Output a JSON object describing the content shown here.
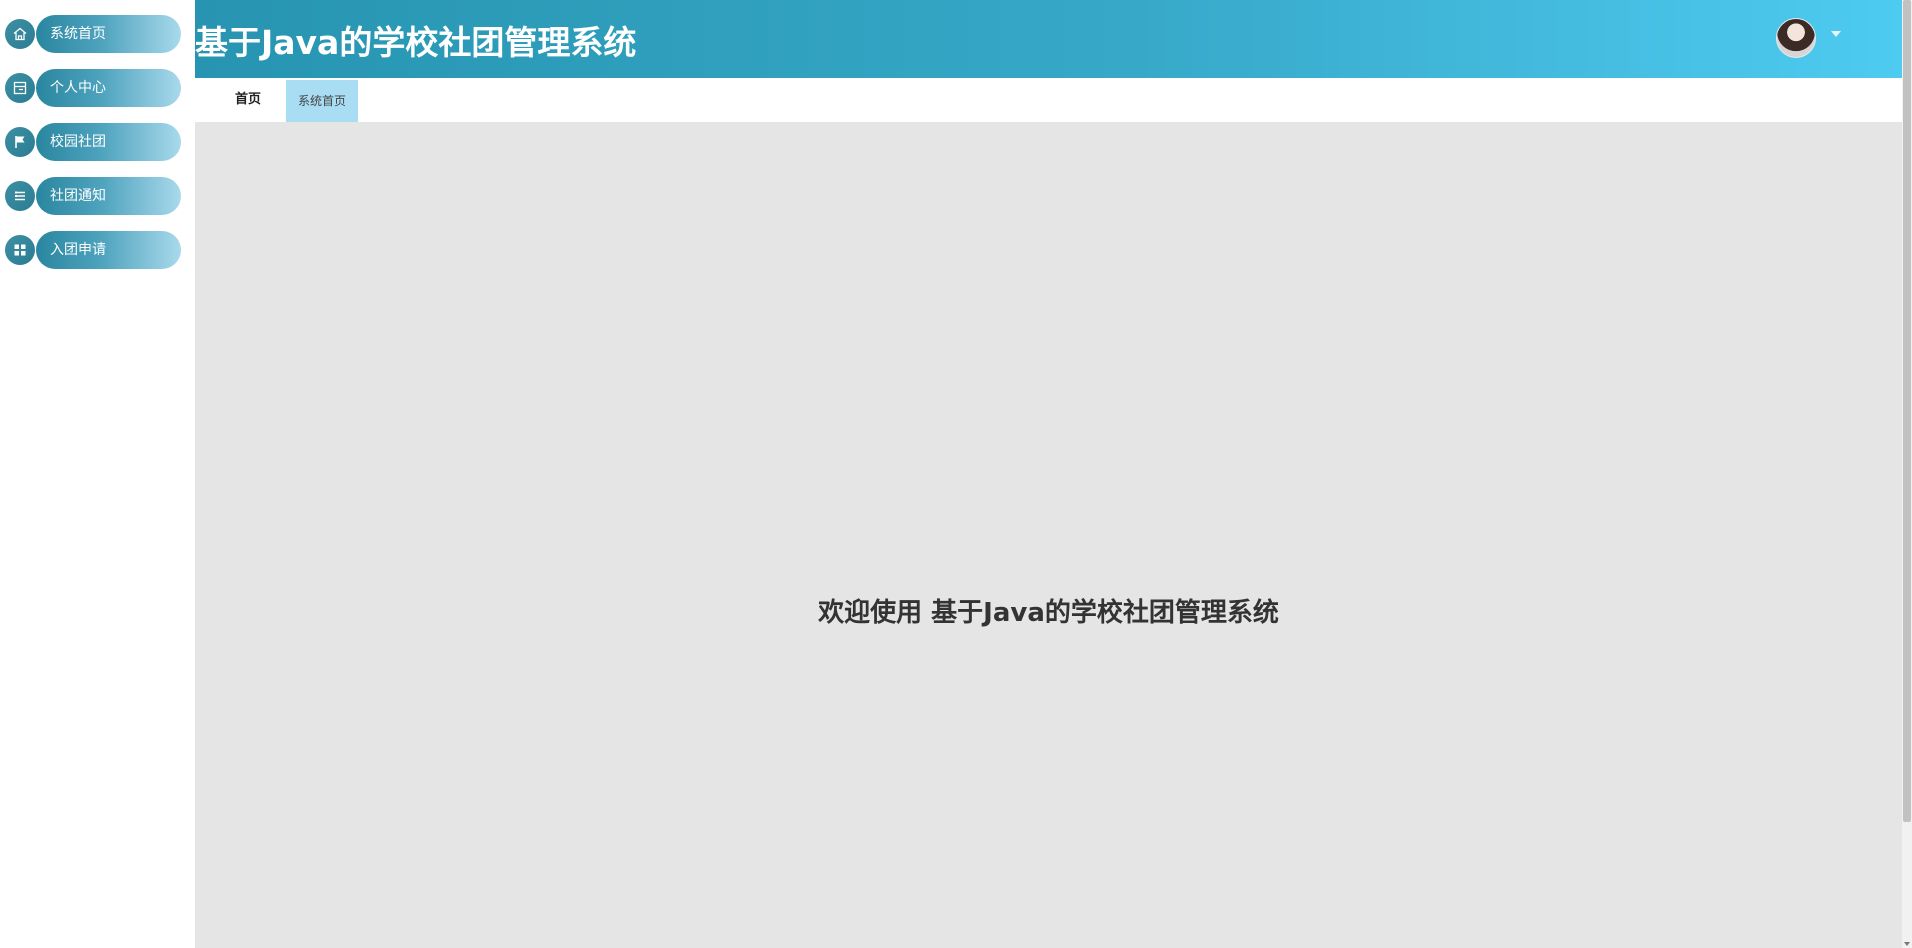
{
  "app": {
    "title": "基于Java的学校社团管理系统"
  },
  "sidebar": {
    "items": [
      {
        "label": "系统首页",
        "icon": "home-icon"
      },
      {
        "label": "个人中心",
        "icon": "profile-card-icon"
      },
      {
        "label": "校园社团",
        "icon": "flag-icon"
      },
      {
        "label": "社团通知",
        "icon": "list-icon"
      },
      {
        "label": "入团申请",
        "icon": "grid-icon"
      }
    ]
  },
  "tabs": {
    "breadcrumb": "首页",
    "active_tab": "系统首页"
  },
  "main": {
    "welcome": "欢迎使用 基于Java的学校社团管理系统"
  },
  "colors": {
    "header_start": "#2795b1",
    "header_end": "#4ecbf1",
    "menu_pill_start": "#2a86a0",
    "menu_pill_end": "#a9d9ec",
    "active_tab_bg": "#a8ddf4",
    "main_bg": "#e5e5e5"
  }
}
